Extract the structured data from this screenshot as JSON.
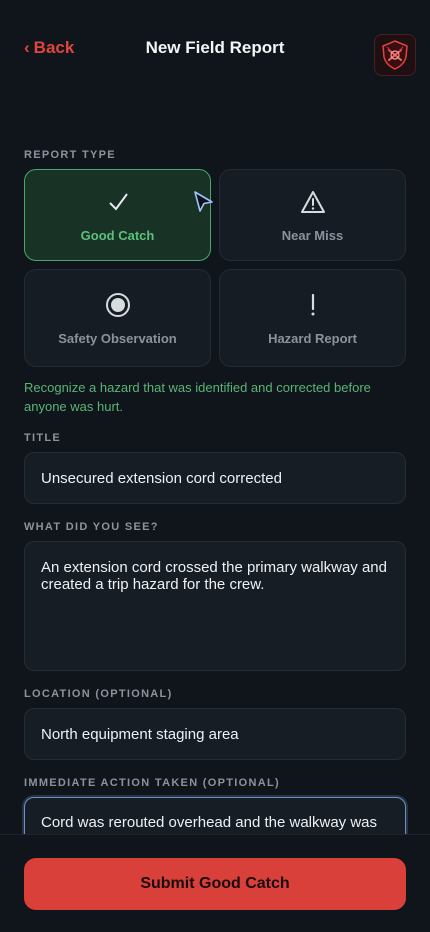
{
  "header": {
    "back_label": "Back",
    "title": "New Field Report",
    "logo_icon": "shield-logo-icon"
  },
  "report_type": {
    "label": "REPORT TYPE",
    "options": [
      {
        "label": "Good Catch",
        "icon": "checkmark-icon",
        "selected": true
      },
      {
        "label": "Near Miss",
        "icon": "warning-triangle-icon",
        "selected": false
      },
      {
        "label": "Safety Observation",
        "icon": "target-icon",
        "selected": false
      },
      {
        "label": "Hazard Report",
        "icon": "exclamation-icon",
        "selected": false
      }
    ],
    "description": "Recognize a hazard that was identified and corrected before anyone was hurt."
  },
  "form": {
    "title_label": "TITLE",
    "title_value": "Unsecured extension cord corrected",
    "what_label": "WHAT DID YOU SEE?",
    "what_value": "An extension cord crossed the primary walkway and created a trip hazard for the crew.",
    "location_label": "LOCATION (OPTIONAL)",
    "location_value": "North equipment staging area",
    "action_label": "IMMEDIATE ACTION TAKEN (OPTIONAL)",
    "action_value": "Cord was rerouted overhead and the walkway was"
  },
  "footer": {
    "submit_label": "Submit Good Catch"
  },
  "colors": {
    "accent_red": "#d9403a",
    "selected_green": "#5cc07c",
    "background": "#10151b"
  }
}
